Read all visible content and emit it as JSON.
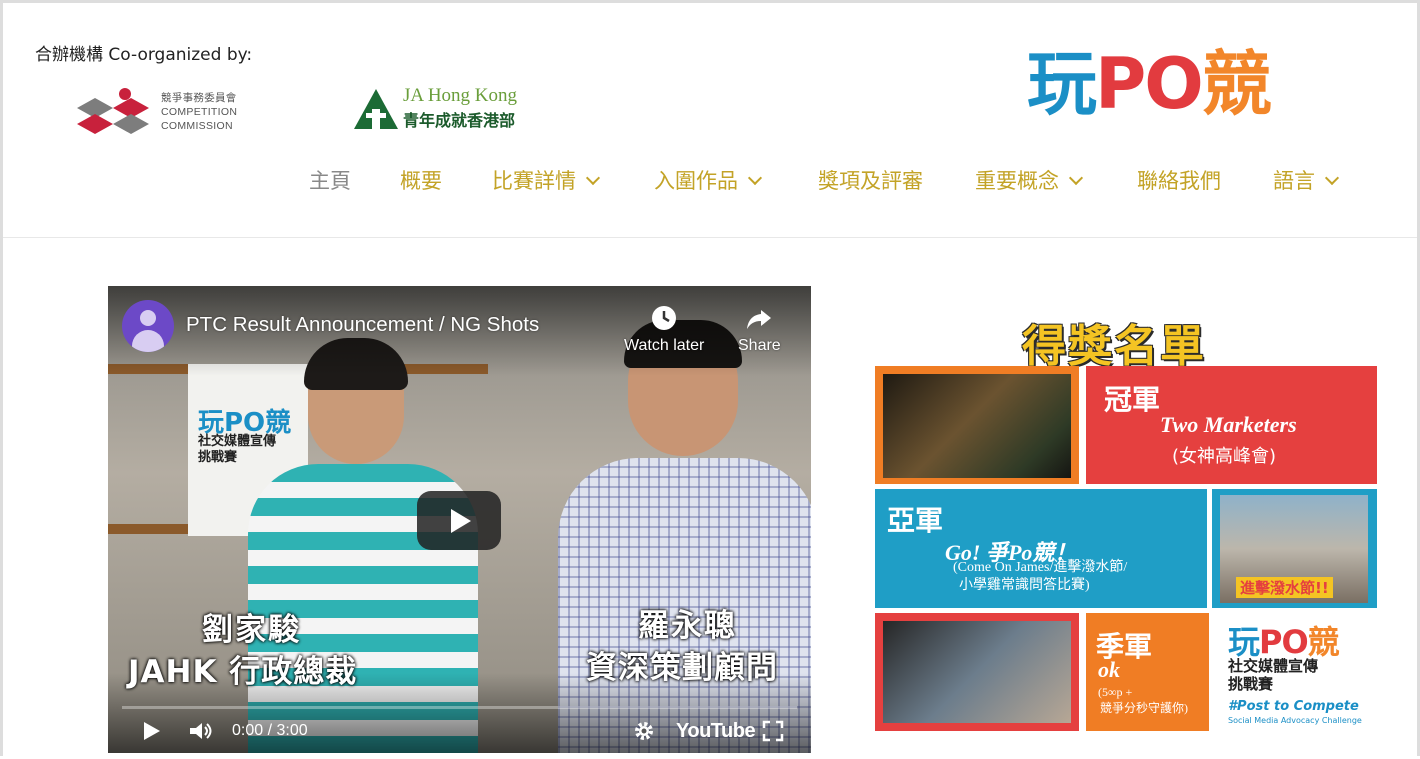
{
  "header": {
    "coorganized_label": "合辦機構 Co-organized by:",
    "competition_commission": {
      "line1": "競爭事務委員會",
      "line2": "COMPETITION",
      "line3": "COMMISSION"
    },
    "ja_hong_kong": {
      "line1": "JA Hong Kong",
      "line2": "青年成就香港部"
    },
    "brand": {
      "part1": "玩",
      "part2": "PO",
      "part3": "競"
    }
  },
  "nav": {
    "items": [
      {
        "label": "主頁",
        "dropdown": false
      },
      {
        "label": "概要",
        "dropdown": false
      },
      {
        "label": "比賽詳情",
        "dropdown": true
      },
      {
        "label": "入圍作品",
        "dropdown": true
      },
      {
        "label": "獎項及評審",
        "dropdown": false
      },
      {
        "label": "重要概念",
        "dropdown": true
      },
      {
        "label": "聯絡我們",
        "dropdown": false
      },
      {
        "label": "語言",
        "dropdown": true
      }
    ]
  },
  "video": {
    "title": "PTC Result Announcement / NG Shots",
    "watch_later": "Watch later",
    "share": "Share",
    "time": "0:00 / 3:00",
    "youtube": "YouTube",
    "captions": {
      "name1": "劉家駿",
      "role1": "JAHK 行政總裁",
      "name2": "羅永聰",
      "role2": "資深策劃顧問"
    },
    "poster": {
      "brand": "玩PO競",
      "line1": "社交媒體宣傳",
      "line2": "挑戰賽"
    },
    "progress": 0
  },
  "awards": {
    "title": "得獎名單",
    "first": {
      "rank": "冠軍",
      "name": "Two Marketers",
      "sub": "(女神高峰會)"
    },
    "second": {
      "rank": "亞軍",
      "name": "Go! 爭Po競！",
      "sub1": "(Come On James/進擊潑水節/",
      "sub2": "小學雞常識問答比賽)"
    },
    "third": {
      "rank": "季軍",
      "name": "ok",
      "sub1": "(5∞p +",
      "sub2": "競爭分秒守護你)"
    },
    "logo": {
      "brand": "玩PO競",
      "line1": "社交媒體宣傳",
      "line2": "挑戰賽",
      "line3": "#Post to Compete",
      "line4": "Social Media Advocacy Challenge"
    },
    "second_photo_caption": "進擊潑水節!!",
    "colors": {
      "orange": "#f07d24",
      "red": "#e5403f",
      "blue": "#1f9ec6",
      "title_yellow": "#f4c423"
    }
  }
}
